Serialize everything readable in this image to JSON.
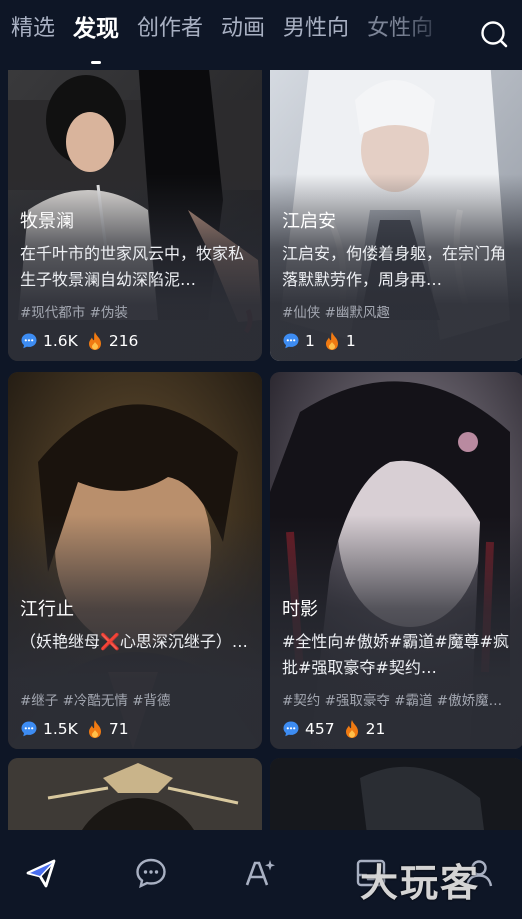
{
  "tabs": [
    {
      "label": "精选"
    },
    {
      "label": "发现"
    },
    {
      "label": "创作者"
    },
    {
      "label": "动画"
    },
    {
      "label": "男性向"
    },
    {
      "label": "女性向"
    }
  ],
  "active_tab": "发现",
  "cards": [
    {
      "title": "牧景澜",
      "desc": "在千叶市的世家风云中，牧家私生子牧景澜自幼深陷泥…",
      "tags": "#现代都市 #伪装",
      "comments": "1.6K",
      "heat": "216"
    },
    {
      "title": "江启安",
      "desc": "江启安，佝偻着身躯，在宗门角落默默劳作，周身再…",
      "tags": "#仙侠 #幽默风趣",
      "comments": "1",
      "heat": "1"
    },
    {
      "title": "江行止",
      "desc": "（妖艳继母❌心思深沉继子）…",
      "tags": "#继子 #冷酷无情 #背德",
      "comments": "1.5K",
      "heat": "71"
    },
    {
      "title": "时影",
      "desc": "#全性向#傲娇#霸道#魔尊#疯批#强取豪夺#契约…",
      "tags": "#契约 #强取豪夺 #霸道 #傲娇魔…",
      "comments": "457",
      "heat": "21"
    }
  ],
  "bottom_nav": [
    {
      "icon": "send-icon"
    },
    {
      "icon": "chat-icon"
    },
    {
      "icon": "ai-sparkle-icon"
    },
    {
      "icon": "inbox-icon"
    },
    {
      "icon": "profile-icon"
    }
  ],
  "watermark": "大玩客",
  "colors": {
    "background": "#0e1626",
    "card": "#2c2e36",
    "comment_icon": "#3d8cf2",
    "flame": "#f07a12"
  }
}
